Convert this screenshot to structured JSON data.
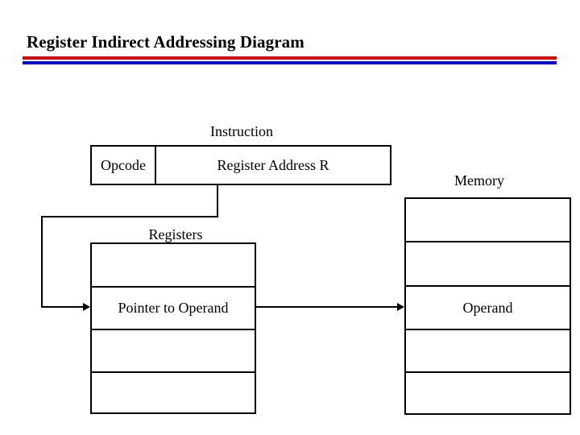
{
  "slide": {
    "title": "Register Indirect Addressing Diagram",
    "accent_red": "#d40000",
    "accent_blue": "#0000cc",
    "line_color": "#000000",
    "background": "#ffffff"
  },
  "instruction": {
    "label": "Instruction",
    "fields": [
      {
        "name": "opcode",
        "text": "Opcode"
      },
      {
        "name": "register-address",
        "text": "Register Address R"
      }
    ]
  },
  "registers": {
    "label": "Registers",
    "rows": [
      {
        "text": ""
      },
      {
        "text": "Pointer to Operand"
      },
      {
        "text": ""
      },
      {
        "text": ""
      }
    ]
  },
  "memory": {
    "label": "Memory",
    "rows": [
      {
        "text": ""
      },
      {
        "text": ""
      },
      {
        "text": "Operand"
      },
      {
        "text": ""
      },
      {
        "text": ""
      }
    ]
  },
  "connectors": [
    {
      "name": "opcode-field-to-registers",
      "from": "register-address-field",
      "to": "registers-row-2"
    },
    {
      "name": "pointer-to-memory-operand",
      "from": "registers-row-2",
      "to": "memory-row-3"
    }
  ]
}
